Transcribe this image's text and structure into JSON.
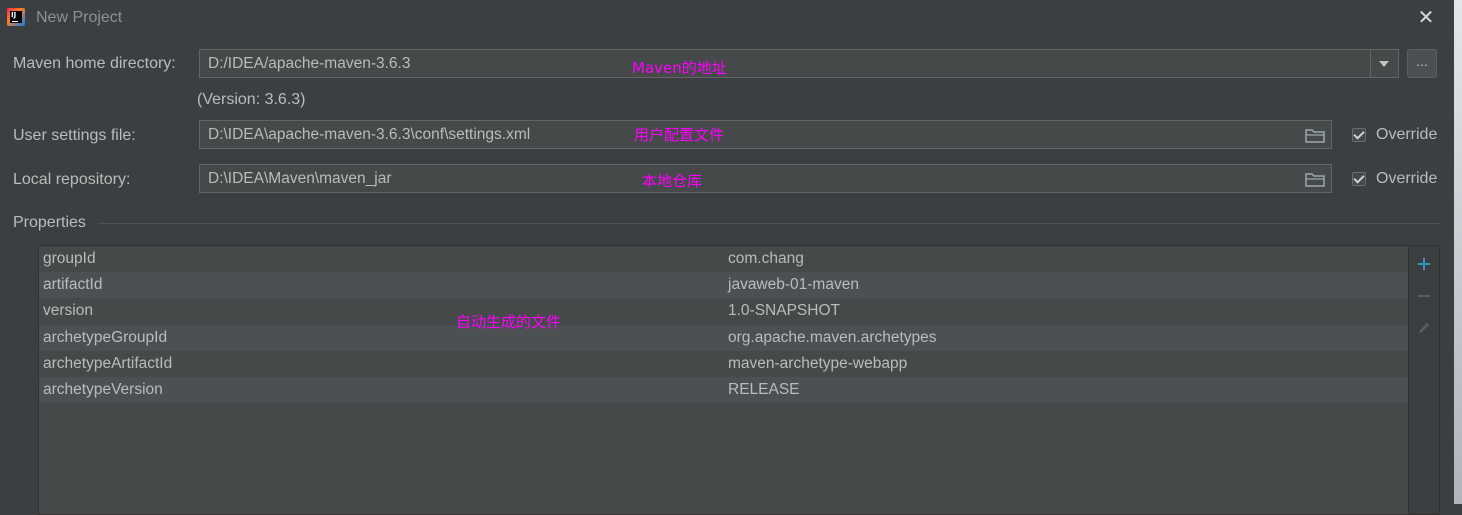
{
  "window": {
    "title": "New Project",
    "close_icon": "close-icon"
  },
  "maven_home": {
    "label": "Maven home directory:",
    "value": "D:/IDEA/apache-maven-3.6.3",
    "version_note": "(Version: 3.6.3)",
    "browse_label": "...",
    "annotation": "Maven的地址"
  },
  "user_settings": {
    "label": "User settings file:",
    "value": "D:\\IDEA\\apache-maven-3.6.3\\conf\\settings.xml",
    "annotation": "用户配置文件",
    "override_label": "Override",
    "override_checked": true
  },
  "local_repository": {
    "label": "Local repository:",
    "value": "D:\\IDEA\\Maven\\maven_jar",
    "annotation": "本地仓库",
    "override_label": "Override",
    "override_checked": true
  },
  "properties": {
    "title": "Properties",
    "annotation": "自动生成的文件",
    "rows": [
      {
        "key": "groupId",
        "value": "com.chang"
      },
      {
        "key": "artifactId",
        "value": "javaweb-01-maven"
      },
      {
        "key": "version",
        "value": "1.0-SNAPSHOT"
      },
      {
        "key": "archetypeGroupId",
        "value": "org.apache.maven.archetypes"
      },
      {
        "key": "archetypeArtifactId",
        "value": "maven-archetype-webapp"
      },
      {
        "key": "archetypeVersion",
        "value": "RELEASE"
      }
    ],
    "toolbar": [
      "add-icon",
      "remove-icon",
      "edit-icon"
    ]
  },
  "colors": {
    "background": "#3c3f41",
    "field_background": "#45494a",
    "annotation": "#ff00ff",
    "add_accent": "#3592c4"
  }
}
